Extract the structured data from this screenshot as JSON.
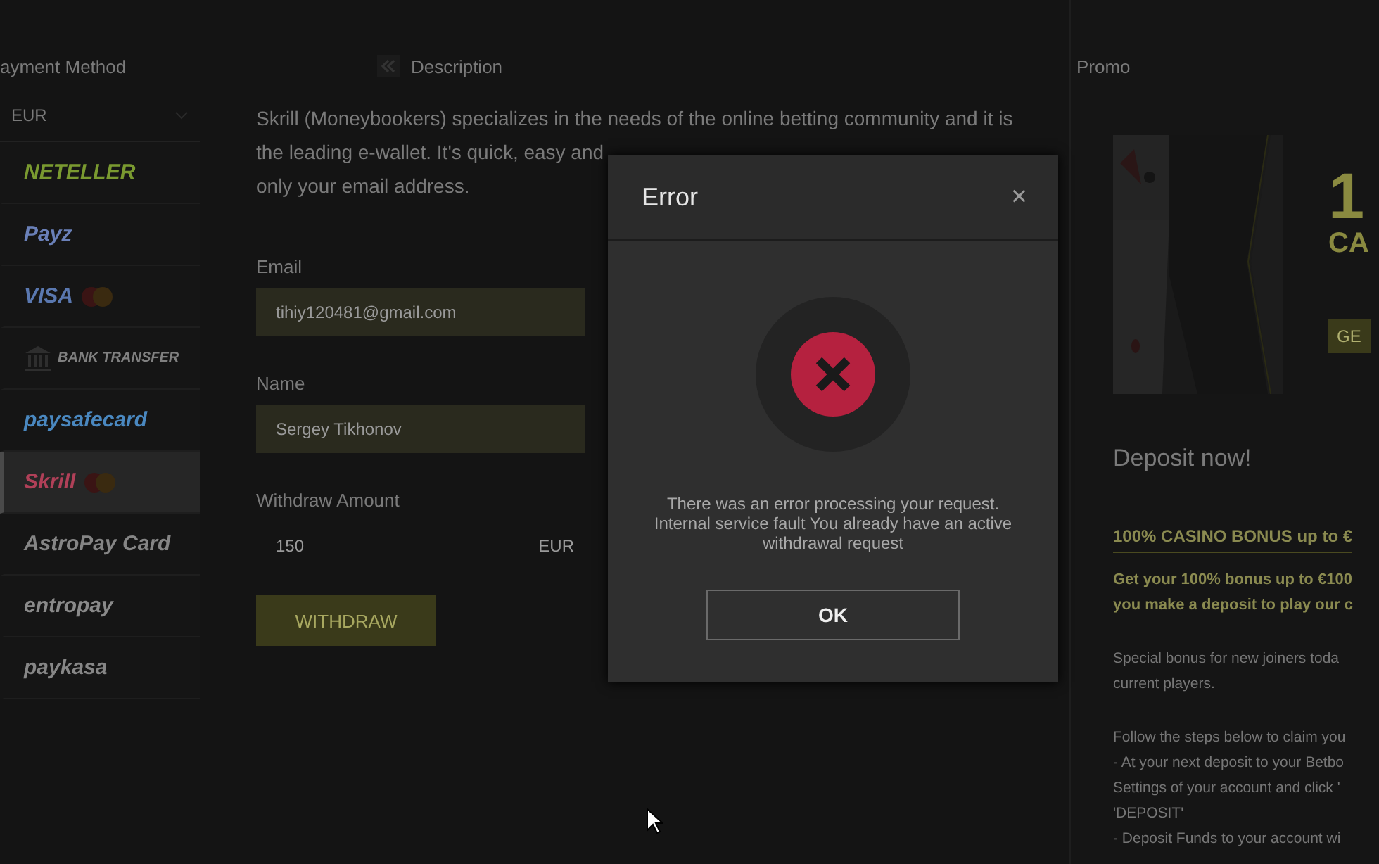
{
  "payment_panel": {
    "title": "ayment Method",
    "currency": "EUR",
    "methods": [
      {
        "label": "NETELLER",
        "kind": "wordmark",
        "color": "#7a9a30",
        "selected": false
      },
      {
        "label": "Payz",
        "kind": "wordmark",
        "color": "#6a80b8",
        "selected": false
      },
      {
        "label": "VISA",
        "kind": "card",
        "color": "#5a78b0",
        "selected": false
      },
      {
        "label": "BANK TRANSFER",
        "kind": "bank",
        "color": "#808080",
        "selected": false
      },
      {
        "label": "paysafecard",
        "kind": "wordmark",
        "color": "#4a88c0",
        "selected": false
      },
      {
        "label": "Skrill",
        "kind": "card",
        "color": "#b04058",
        "selected": true
      },
      {
        "label": "AstroPay Card",
        "kind": "wordmark",
        "color": "#858585",
        "selected": false
      },
      {
        "label": "entropay",
        "kind": "wordmark",
        "color": "#8a8a8a",
        "selected": false
      },
      {
        "label": "paykasa",
        "kind": "wordmark",
        "color": "#868686",
        "selected": false
      }
    ]
  },
  "description": {
    "title": "Description",
    "lines": [
      "Skrill (Moneybookers) specializes in the needs of the online betting community and it is",
      "the leading e-wallet. It's quick, easy and",
      "only your email address."
    ],
    "email": {
      "label": "Email",
      "value": "tihiy120481@gmail.com"
    },
    "name": {
      "label": "Name",
      "value": "Sergey Tikhonov"
    },
    "amount": {
      "label": "Withdraw Amount",
      "value": "150",
      "currency": "EUR"
    },
    "submit": "WITHDRAW"
  },
  "promo": {
    "title": "Promo",
    "banner": {
      "kind": "picture",
      "headline": "1",
      "subhead": "CA",
      "button": "GE"
    },
    "heading": "Deposit now!",
    "bonus_title": "100% CASINO BONUS up to €",
    "bonus_lead": [
      "Get your 100% bonus up to €100",
      "you make a deposit to play our c"
    ],
    "paragraphs": [
      [
        "Special bonus for new joiners toda",
        "current players."
      ],
      [
        "Follow the steps below to claim you",
        "- At your next deposit to your Betbo",
        "Settings of your account and click '",
        "'DEPOSIT'",
        "- Deposit Funds to your account wi"
      ]
    ]
  },
  "dialog": {
    "title": "Error",
    "close": "×",
    "message": "There was an error processing your request. Internal service fault You already have an active withdrawal request",
    "button": "OK"
  }
}
